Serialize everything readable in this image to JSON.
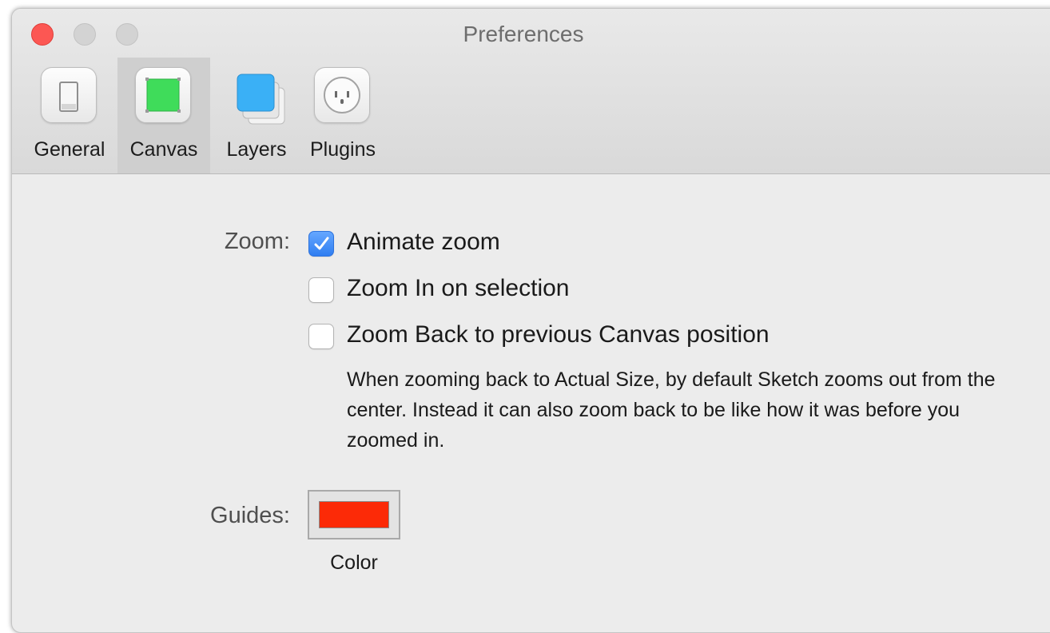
{
  "window": {
    "title": "Preferences"
  },
  "tabs": [
    {
      "label": "General",
      "icon": "light-switch-icon",
      "selected": false
    },
    {
      "label": "Canvas",
      "icon": "canvas-artboard-icon",
      "selected": true
    },
    {
      "label": "Layers",
      "icon": "layers-stack-icon",
      "selected": false
    },
    {
      "label": "Plugins",
      "icon": "plug-socket-icon",
      "selected": false
    }
  ],
  "zoom": {
    "label": "Zoom:",
    "options": [
      {
        "label": "Animate zoom",
        "checked": true
      },
      {
        "label": "Zoom In on selection",
        "checked": false
      },
      {
        "label": "Zoom Back to previous Canvas position",
        "checked": false
      }
    ],
    "help_text": "When zooming back to Actual Size, by default Sketch zooms out from the center. Instead it can also zoom back to be like how it was before you zoomed in."
  },
  "guides": {
    "label": "Guides:",
    "color_caption": "Color",
    "color": "#fc2a07"
  },
  "colors": {
    "accent": "#2f7ef1",
    "close_button": "#fc5753",
    "canvas_icon_green": "#3fdc5a",
    "layers_icon_blue": "#3ab0f6"
  }
}
